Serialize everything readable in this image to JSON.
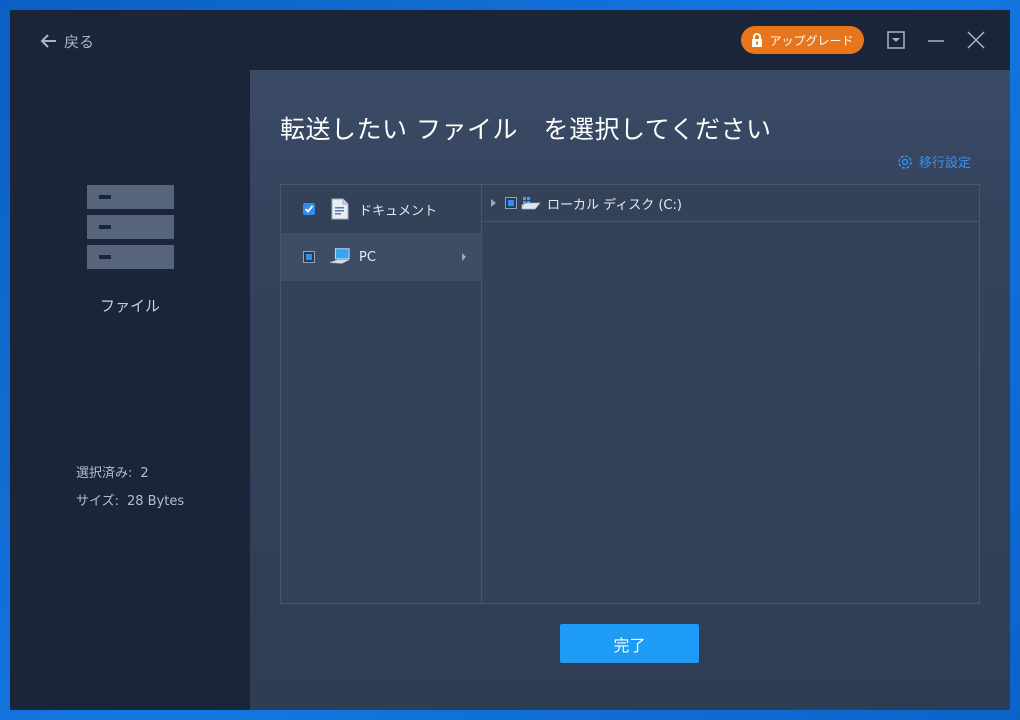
{
  "titlebar": {
    "back_label": "戻る",
    "upgrade_label": "アップグレード"
  },
  "sidebar": {
    "category_label": "ファイル",
    "stats": [
      {
        "label": "選択済み:",
        "value": "2"
      },
      {
        "label": "サイズ:",
        "value": "28 Bytes"
      }
    ]
  },
  "main": {
    "heading": "転送したい ファイル　を選択してください",
    "migrate_settings_label": "移行設定",
    "left_items": [
      {
        "label": "ドキュメント",
        "state": "checked",
        "icon": "document-icon"
      },
      {
        "label": "PC",
        "state": "partial",
        "icon": "pc-icon",
        "selected": true
      }
    ],
    "tree": [
      {
        "label": "ローカル ディスク (C:)",
        "state": "partial",
        "icon": "drive-icon"
      }
    ],
    "done_label": "完了"
  },
  "colors": {
    "accent": "#1e9bf5",
    "upgrade": "#e8741c",
    "window_bg": "#1b2539",
    "panel_bg": "#334258"
  }
}
